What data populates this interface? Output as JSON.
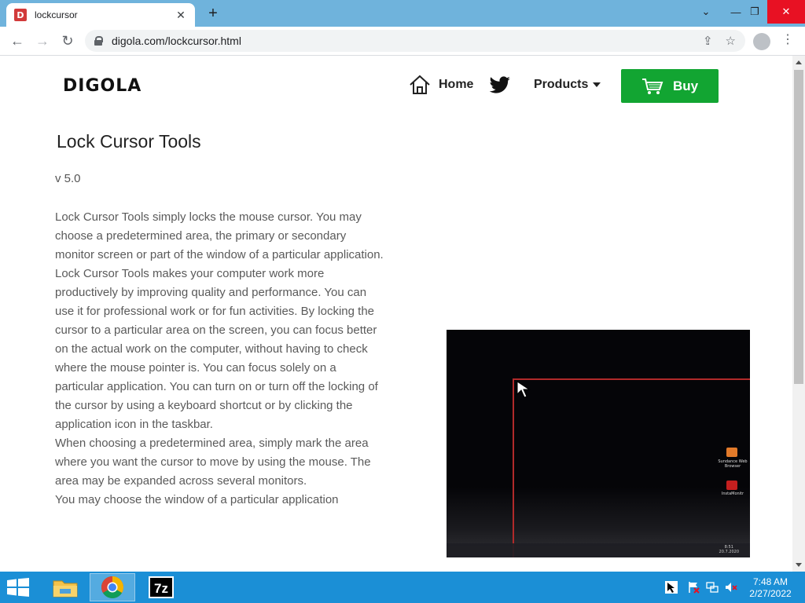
{
  "browser": {
    "tab_title": "lockcursor",
    "favicon_letter": "D",
    "url": "digola.com/lockcursor.html"
  },
  "site": {
    "logo": "DIGOLA",
    "nav": {
      "home": "Home",
      "products": "Products",
      "buy": "Buy"
    },
    "accent_color": "#12a532"
  },
  "content": {
    "title": "Lock Cursor Tools",
    "version": "v 5.0",
    "paragraphs": [
      "Lock Cursor Tools simply locks the mouse cursor. You may choose a predetermined area, the primary or secondary monitor screen or part of the window of a particular application.",
      "Lock Cursor Tools makes your computer work more productively by improving quality and performance. You can use it for professional work or for fun activities. By locking the cursor to a particular area on the screen, you can focus better on the actual work on the computer, without having to check where the mouse pointer is. You can focus solely on a particular application. You can turn on or turn off the locking of the cursor by using a keyboard shortcut or by clicking the application icon in the taskbar.",
      "When choosing a predetermined area, simply mark the area where you want the cursor to move by using the mouse. The area may be expanded across several monitors.",
      "You may choose the window of a particular application"
    ]
  },
  "screenshot_preview": {
    "desktop_icon_1": "Sundance Web Browser",
    "desktop_icon_2": "InstaMonitr",
    "tray_time": "8:51",
    "tray_date": "20.7.2020"
  },
  "taskbar": {
    "time": "7:48 AM",
    "date": "2/27/2022",
    "apps": [
      "file-explorer",
      "chrome",
      "7-zip"
    ]
  }
}
